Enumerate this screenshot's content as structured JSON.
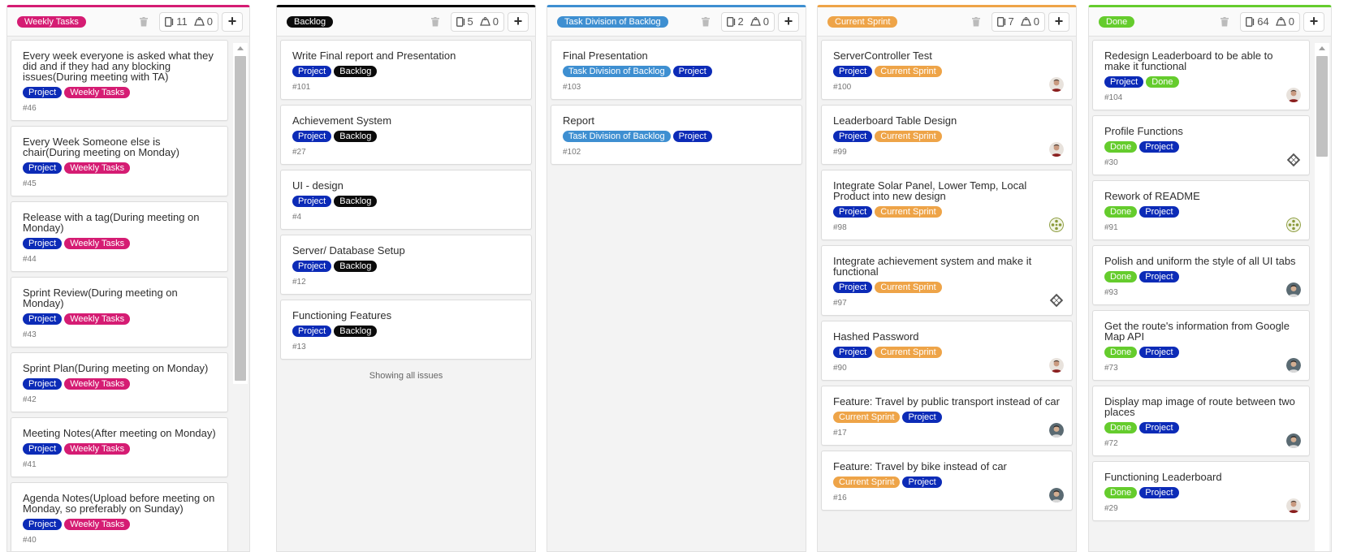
{
  "colors": {
    "project": "#0c2bb7",
    "weekly_tasks": "#d51c73",
    "backlog": "#0b0b0b",
    "task_division": "#3e8fd1",
    "current_sprint": "#eea448",
    "done": "#65cc2d"
  },
  "columns": [
    {
      "label": "Weekly Tasks",
      "issues_count": "11",
      "weight": "0",
      "cards": [
        {
          "title": "Every week everyone is asked what they did and if they had any blocking issues(During meeting with TA)",
          "labels": [
            "Project",
            "Weekly Tasks"
          ],
          "number": "#46"
        },
        {
          "title": "Every Week Someone else is chair(During meeting on Monday)",
          "labels": [
            "Project",
            "Weekly Tasks"
          ],
          "number": "#45"
        },
        {
          "title": "Release with a tag(During meeting on Monday)",
          "labels": [
            "Project",
            "Weekly Tasks"
          ],
          "number": "#44"
        },
        {
          "title": "Sprint Review(During meeting on Monday)",
          "labels": [
            "Project",
            "Weekly Tasks"
          ],
          "number": "#43"
        },
        {
          "title": "Sprint Plan(During meeting on Monday)",
          "labels": [
            "Project",
            "Weekly Tasks"
          ],
          "number": "#42"
        },
        {
          "title": "Meeting Notes(After meeting on Monday)",
          "labels": [
            "Project",
            "Weekly Tasks"
          ],
          "number": "#41"
        },
        {
          "title": "Agenda Notes(Upload before meeting on Monday, so preferably on Sunday)",
          "labels": [
            "Project",
            "Weekly Tasks"
          ],
          "number": "#40"
        }
      ]
    },
    {
      "label": "Backlog",
      "issues_count": "5",
      "weight": "0",
      "footer": "Showing all issues",
      "cards": [
        {
          "title": "Write Final report and Presentation",
          "labels": [
            "Project",
            "Backlog"
          ],
          "number": "#101"
        },
        {
          "title": "Achievement System",
          "labels": [
            "Project",
            "Backlog"
          ],
          "number": "#27"
        },
        {
          "title": "UI - design",
          "labels": [
            "Project",
            "Backlog"
          ],
          "number": "#4"
        },
        {
          "title": "Server/ Database Setup",
          "labels": [
            "Project",
            "Backlog"
          ],
          "number": "#12"
        },
        {
          "title": "Functioning Features",
          "labels": [
            "Project",
            "Backlog"
          ],
          "number": "#13"
        }
      ]
    },
    {
      "label": "Task Division of Backlog",
      "issues_count": "2",
      "weight": "0",
      "cards": [
        {
          "title": "Final Presentation",
          "labels": [
            "Task Division of Backlog",
            "Project"
          ],
          "number": "#103"
        },
        {
          "title": "Report",
          "labels": [
            "Task Division of Backlog",
            "Project"
          ],
          "number": "#102"
        }
      ]
    },
    {
      "label": "Current Sprint",
      "issues_count": "7",
      "weight": "0",
      "cards": [
        {
          "title": "ServerController Test",
          "labels": [
            "Project",
            "Current Sprint"
          ],
          "number": "#100",
          "avatar": "photo-a"
        },
        {
          "title": "Leaderboard Table Design",
          "labels": [
            "Project",
            "Current Sprint"
          ],
          "number": "#99",
          "avatar": "photo-a"
        },
        {
          "title": "Integrate Solar Panel, Lower Temp, Local Product into new design",
          "labels": [
            "Project",
            "Current Sprint"
          ],
          "number": "#98",
          "avatar": "identicon-green"
        },
        {
          "title": "Integrate achievement system and make it functional",
          "labels": [
            "Project",
            "Current Sprint"
          ],
          "number": "#97",
          "avatar": "identicon-grey"
        },
        {
          "title": "Hashed Password",
          "labels": [
            "Project",
            "Current Sprint"
          ],
          "number": "#90",
          "avatar": "photo-a"
        },
        {
          "title": "Feature: Travel by public transport instead of car",
          "labels": [
            "Current Sprint",
            "Project"
          ],
          "number": "#17",
          "avatar": "photo-b"
        },
        {
          "title": "Feature: Travel by bike instead of car",
          "labels": [
            "Current Sprint",
            "Project"
          ],
          "number": "#16",
          "avatar": "photo-b"
        }
      ]
    },
    {
      "label": "Done",
      "issues_count": "64",
      "weight": "0",
      "cards": [
        {
          "title": "Redesign Leaderboard to be able to make it functional",
          "labels": [
            "Project",
            "Done"
          ],
          "number": "#104",
          "avatar": "photo-a"
        },
        {
          "title": "Profile Functions",
          "labels": [
            "Done",
            "Project"
          ],
          "number": "#30",
          "avatar": "identicon-grey"
        },
        {
          "title": "Rework of README",
          "labels": [
            "Done",
            "Project"
          ],
          "number": "#91",
          "avatar": "identicon-green"
        },
        {
          "title": "Polish and uniform the style of all UI tabs",
          "labels": [
            "Done",
            "Project"
          ],
          "number": "#93",
          "avatar": "photo-b"
        },
        {
          "title": "Get the route's information from Google Map API",
          "labels": [
            "Done",
            "Project"
          ],
          "number": "#73",
          "avatar": "photo-b"
        },
        {
          "title": "Display map image of route between two places",
          "labels": [
            "Done",
            "Project"
          ],
          "number": "#72",
          "avatar": "photo-b"
        },
        {
          "title": "Functioning Leaderboard",
          "labels": [
            "Done",
            "Project"
          ],
          "number": "#29",
          "avatar": "photo-a"
        }
      ]
    }
  ]
}
